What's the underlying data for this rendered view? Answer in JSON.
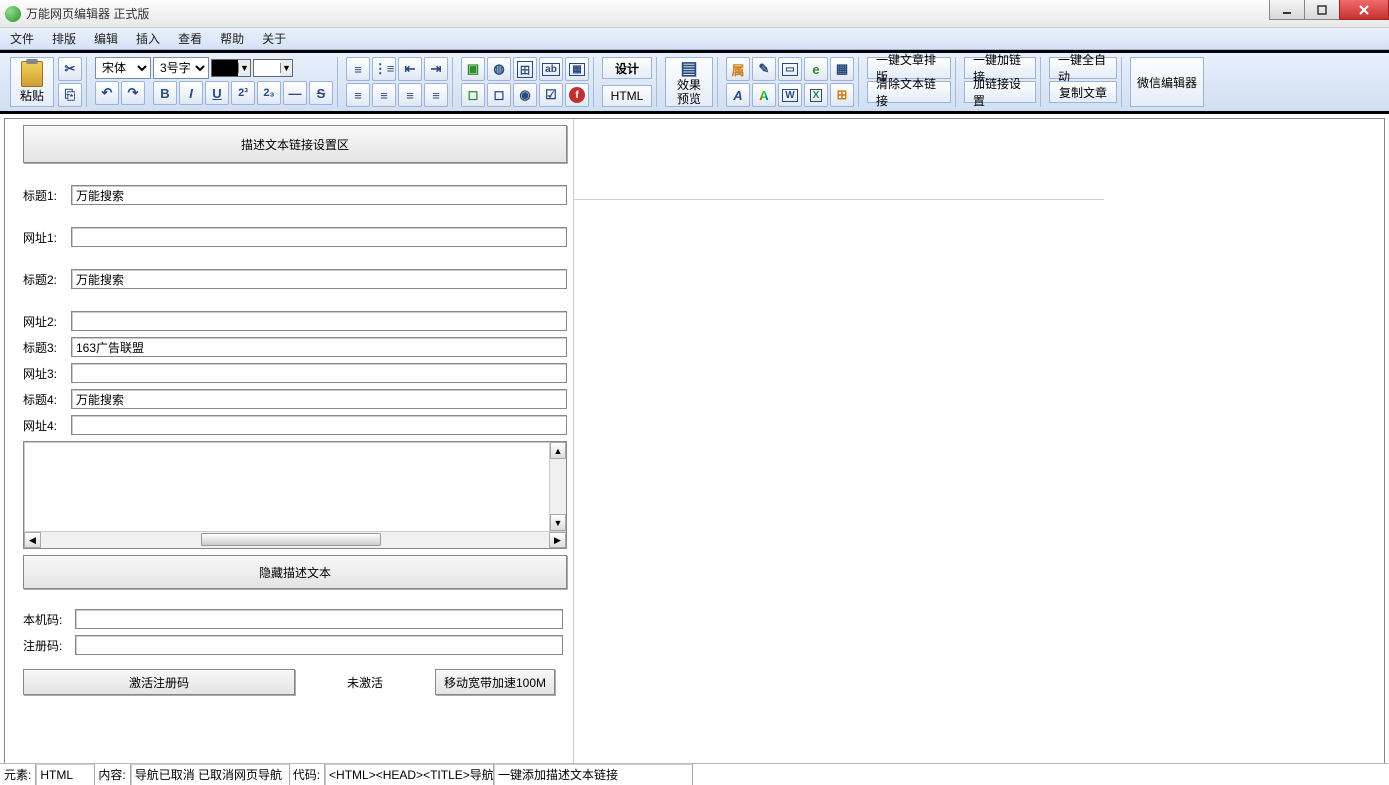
{
  "window": {
    "title": "万能网页编辑器 正式版"
  },
  "menu": [
    "文件",
    "排版",
    "编辑",
    "插入",
    "查看",
    "帮助",
    "关于"
  ],
  "toolbar": {
    "paste": "粘贴",
    "font_family": "宋体",
    "font_size": "3号字",
    "design_label": "设计",
    "preview_label": "效果\n预览",
    "html_label": "HTML",
    "buttons": {
      "one_key_layout": "一键文章排版",
      "one_key_link": "一键加链接",
      "one_key_auto": "一键全自动",
      "clear_link": "清除文本链接",
      "link_setting": "加链接设置",
      "copy_article": "复制文章",
      "wechat_editor": "微信编辑器"
    }
  },
  "panel": {
    "header": "描述文本链接设置区",
    "rows": [
      {
        "label": "标题1:",
        "value": "万能搜索"
      },
      {
        "label": "网址1:",
        "value": ""
      },
      {
        "label": "标题2:",
        "value": "万能搜索"
      },
      {
        "label": "网址2:",
        "value": ""
      },
      {
        "label": "标题3:",
        "value": "163广告联盟"
      },
      {
        "label": "网址3:",
        "value": ""
      },
      {
        "label": "标题4:",
        "value": "万能搜索"
      },
      {
        "label": "网址4:",
        "value": ""
      }
    ],
    "hide_desc": "隐藏描述文本",
    "machine_code_label": "本机码:",
    "machine_code": "",
    "reg_code_label": "注册码:",
    "reg_code": "",
    "activate": "激活注册码",
    "not_activated": "未激活",
    "broadband": "移动宽带加速100M"
  },
  "status": {
    "element_label": "元素:",
    "element": "HTML",
    "content_label": "内容:",
    "content": "导航已取消 已取消网页导航",
    "code_label": "代码:",
    "code": "<HTML><HEAD><TITLE>导航已取",
    "action": "一键添加描述文本链接"
  }
}
